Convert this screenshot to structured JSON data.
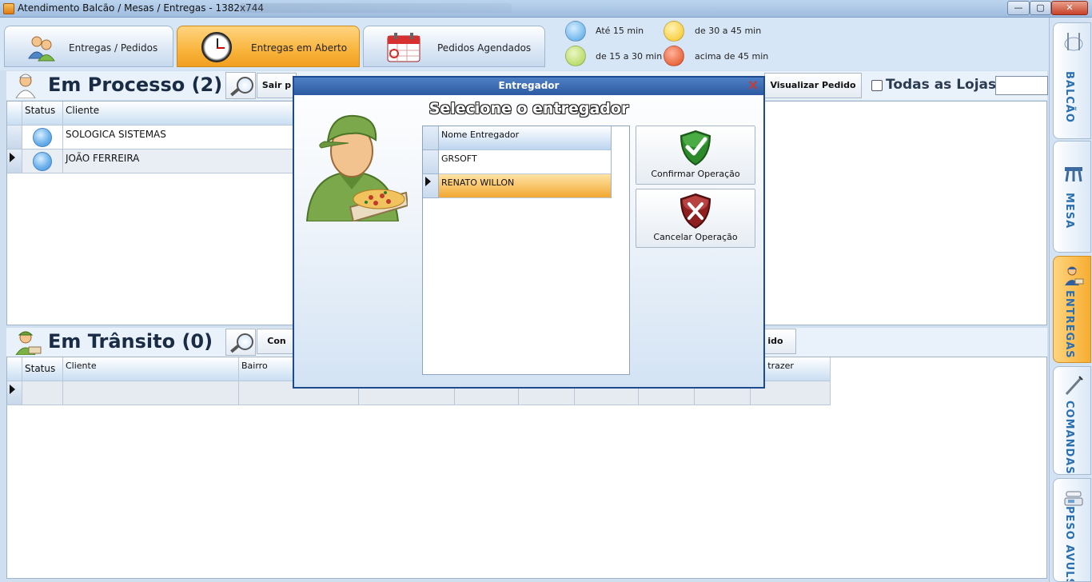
{
  "window": {
    "title": "Atendimento Balcão / Mesas / Entregas - 1382x744",
    "minimize": "—",
    "maximize": "▢",
    "close": "✕"
  },
  "top_tabs": [
    {
      "label": "Entregas / Pedidos",
      "active": false
    },
    {
      "label": "Entregas em Aberto",
      "active": true
    },
    {
      "label": "Pedidos Agendados",
      "active": false
    }
  ],
  "legend": [
    {
      "label": "Até 15 min",
      "color": "#4aa3e6"
    },
    {
      "label": "de 15 a 30 min",
      "color": "#a8d24a"
    },
    {
      "label": "de 30 a 45 min",
      "color": "#f6c21a"
    },
    {
      "label": "acima de 45 min",
      "color": "#e0481b"
    }
  ],
  "processo": {
    "title": "Em Processo (2)",
    "buttons": {
      "sair": "Sair p",
      "visualizar": "Visualizar Pedido"
    },
    "todas_lojas": "Todas as Lojas",
    "columns": {
      "status": "Status",
      "cliente": "Cliente"
    },
    "rows": [
      {
        "cliente": "SOLOGICA SISTEMAS"
      },
      {
        "cliente": "JOÃO FERREIRA"
      }
    ]
  },
  "transito": {
    "title": "Em Trânsito (0)",
    "buttons": {
      "con": "Con",
      "ido": "ido"
    },
    "columns": {
      "status": "Status",
      "cliente": "Cliente",
      "bairro": "Bairro",
      "trazer": "r a trazer"
    }
  },
  "sidebar": [
    {
      "label": "BALCÃO",
      "active": false
    },
    {
      "label": "MESA",
      "active": false
    },
    {
      "label": "ENTREGAS",
      "active": true
    },
    {
      "label": "COMANDAS",
      "active": false
    },
    {
      "label": "PESO AVULSO",
      "active": false
    }
  ],
  "modal": {
    "title": "Entregador",
    "close": "✕",
    "heading": "Selecione o entregador",
    "list_header": "Nome Entregador",
    "entregadores": [
      {
        "nome": "GRSOFT",
        "selected": false
      },
      {
        "nome": "RENATO WILLON",
        "selected": true
      }
    ],
    "confirm": "Confirmar Operação",
    "cancel": "Cancelar Operação"
  }
}
